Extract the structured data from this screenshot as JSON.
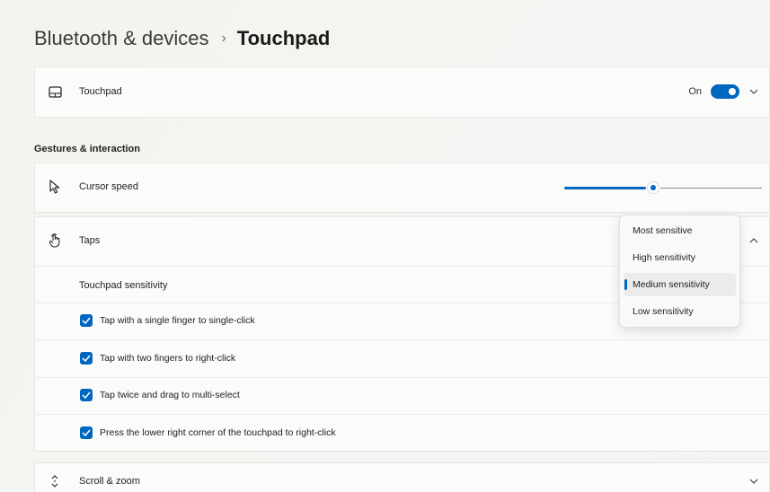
{
  "breadcrumb": {
    "parent": "Bluetooth & devices",
    "separator": "›",
    "current": "Touchpad"
  },
  "touchpad_row": {
    "icon": "touchpad-icon",
    "label": "Touchpad",
    "state_label": "On",
    "toggle_on": true,
    "chevron": "chevron-down-icon"
  },
  "section": {
    "heading": "Gestures & interaction"
  },
  "cursor_speed": {
    "icon": "cursor-icon",
    "label": "Cursor speed",
    "value_fraction": 0.45
  },
  "taps": {
    "icon": "tap-hand-icon",
    "label": "Taps",
    "chevron": "chevron-up-icon",
    "sensitivity_label": "Touchpad sensitivity",
    "options": [
      {
        "label": "Tap with a single finger to single-click",
        "checked": true
      },
      {
        "label": "Tap with two fingers to right-click",
        "checked": true
      },
      {
        "label": "Tap twice and drag to multi-select",
        "checked": true
      },
      {
        "label": "Press the lower right corner of the touchpad to right-click",
        "checked": true
      }
    ]
  },
  "sensitivity_dropdown": {
    "items": [
      {
        "label": "Most sensitive",
        "selected": false
      },
      {
        "label": "High sensitivity",
        "selected": false
      },
      {
        "label": "Medium sensitivity",
        "selected": true
      },
      {
        "label": "Low sensitivity",
        "selected": false
      }
    ]
  },
  "scroll_zoom": {
    "icon": "scroll-icon",
    "label": "Scroll & zoom",
    "chevron": "chevron-down-icon"
  },
  "colors": {
    "accent": "#0067c0"
  }
}
